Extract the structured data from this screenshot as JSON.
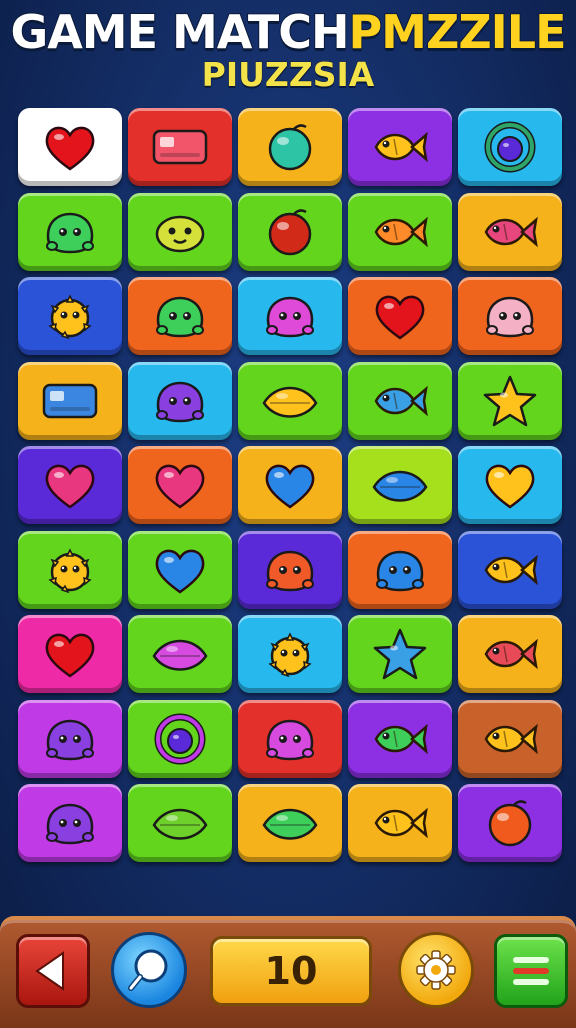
{
  "header": {
    "title_part1": "GAME MATCH",
    "title_part2": "PMZZILE",
    "subtitle": "PIUZZSIA"
  },
  "board": {
    "rows": [
      [
        {
          "bg": "#ffffff",
          "icon": "heart-icon",
          "color": "#e3141c"
        },
        {
          "bg": "#e3302a",
          "icon": "block-icon",
          "color": "#f2556a"
        },
        {
          "bg": "#f6b21a",
          "icon": "orb-icon",
          "color": "#2cc4a4"
        },
        {
          "bg": "#8d2fe3",
          "icon": "fish-icon",
          "color": "#ffc21c"
        },
        {
          "bg": "#27b8ee",
          "icon": "ring-icon",
          "color": "#2ea66a"
        }
      ],
      [
        {
          "bg": "#62d51c",
          "icon": "creature-icon",
          "color": "#3ecf5a"
        },
        {
          "bg": "#62d51c",
          "icon": "slime-icon",
          "color": "#d6e03a"
        },
        {
          "bg": "#62d51c",
          "icon": "orb-icon",
          "color": "#d22a18"
        },
        {
          "bg": "#62d51c",
          "icon": "fish-icon",
          "color": "#ff8a2a"
        },
        {
          "bg": "#f6b21a",
          "icon": "fish-icon",
          "color": "#e8477e"
        }
      ],
      [
        {
          "bg": "#2a53d8",
          "icon": "puffer-icon",
          "color": "#ffc21c"
        },
        {
          "bg": "#f0651e",
          "icon": "creature-icon",
          "color": "#3ecf5a"
        },
        {
          "bg": "#27b8ee",
          "icon": "creature-icon",
          "color": "#e04ad8"
        },
        {
          "bg": "#f0651e",
          "icon": "heart-icon",
          "color": "#e3141c"
        },
        {
          "bg": "#f0651e",
          "icon": "creature-icon",
          "color": "#f4b0c4"
        }
      ],
      [
        {
          "bg": "#f6b21a",
          "icon": "block-icon",
          "color": "#3a86e0"
        },
        {
          "bg": "#27b8ee",
          "icon": "creature-icon",
          "color": "#8a3fe0"
        },
        {
          "bg": "#62d51c",
          "icon": "leaf-icon",
          "color": "#ffc21c"
        },
        {
          "bg": "#62d51c",
          "icon": "fish-icon",
          "color": "#3aa0e6"
        },
        {
          "bg": "#62d51c",
          "icon": "star-icon",
          "color": "#ffc21c"
        }
      ],
      [
        {
          "bg": "#5a2ad8",
          "icon": "heart-icon",
          "color": "#e8377e"
        },
        {
          "bg": "#f0651e",
          "icon": "heart-icon",
          "color": "#e8377e"
        },
        {
          "bg": "#f6b21a",
          "icon": "heart-icon",
          "color": "#2a86e6"
        },
        {
          "bg": "#a6e01c",
          "icon": "leaf-icon",
          "color": "#2a86e6"
        },
        {
          "bg": "#27b8ee",
          "icon": "heart-icon",
          "color": "#ffc21c"
        }
      ],
      [
        {
          "bg": "#62d51c",
          "icon": "puffer-icon",
          "color": "#ffc21c"
        },
        {
          "bg": "#62d51c",
          "icon": "heart-icon",
          "color": "#2a86e6"
        },
        {
          "bg": "#5a2ad8",
          "icon": "creature-icon",
          "color": "#f05a28"
        },
        {
          "bg": "#f0651e",
          "icon": "creature-icon",
          "color": "#2a86e6"
        },
        {
          "bg": "#2a53d8",
          "icon": "fish-icon",
          "color": "#ffc21c"
        }
      ],
      [
        {
          "bg": "#ef2aa6",
          "icon": "heart-icon",
          "color": "#e3141c"
        },
        {
          "bg": "#62d51c",
          "icon": "leaf-icon",
          "color": "#d64ae0"
        },
        {
          "bg": "#27b8ee",
          "icon": "puffer-icon",
          "color": "#ffc21c"
        },
        {
          "bg": "#62d51c",
          "icon": "star-icon",
          "color": "#3aa0e6"
        },
        {
          "bg": "#f6b21a",
          "icon": "fish-icon",
          "color": "#e84a58"
        }
      ],
      [
        {
          "bg": "#c03ae6",
          "icon": "creature-icon",
          "color": "#8a3fe0"
        },
        {
          "bg": "#62d51c",
          "icon": "ring-icon",
          "color": "#c03ae6"
        },
        {
          "bg": "#e3302a",
          "icon": "creature-icon",
          "color": "#d64ae0"
        },
        {
          "bg": "#8d2fe3",
          "icon": "fish-icon",
          "color": "#3ecf5a"
        },
        {
          "bg": "#c8622a",
          "icon": "fish-icon",
          "color": "#ffc21c"
        }
      ],
      [
        {
          "bg": "#c03ae6",
          "icon": "creature-icon",
          "color": "#8a3fe0"
        },
        {
          "bg": "#62d51c",
          "icon": "leaf-icon",
          "color": "#6ed02a"
        },
        {
          "bg": "#f6b21a",
          "icon": "leaf-icon",
          "color": "#3ecf5a"
        },
        {
          "bg": "#f6b21a",
          "icon": "fish-icon",
          "color": "#ffc21c"
        },
        {
          "bg": "#8d2fe3",
          "icon": "orb-icon",
          "color": "#f05a1c"
        }
      ]
    ]
  },
  "bottom_bar": {
    "counter_value": "10"
  }
}
